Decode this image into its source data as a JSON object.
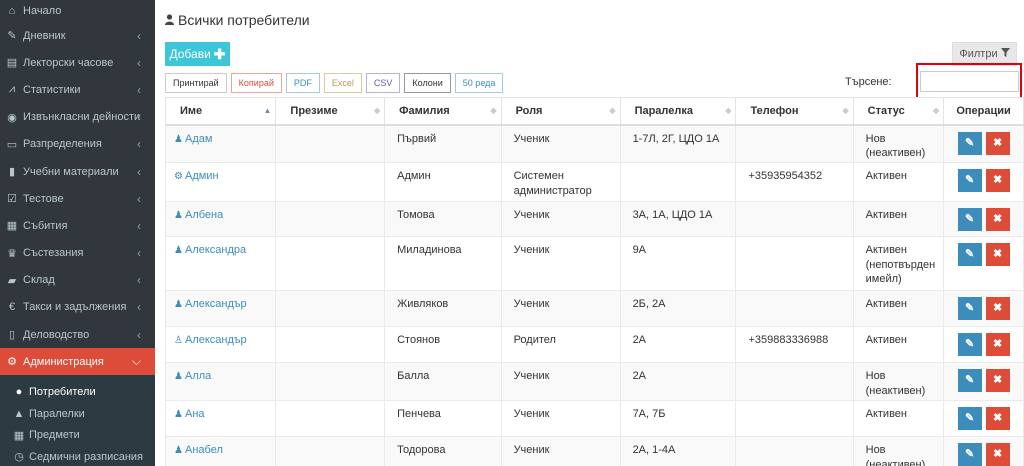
{
  "sidebar": {
    "items": [
      {
        "label": "Начало",
        "icon": "home-icon",
        "glyph": "⌂",
        "chevron": false,
        "active": false
      },
      {
        "label": "Дневник",
        "icon": "pencil-square-icon",
        "glyph": "✎",
        "chevron": true,
        "active": false
      },
      {
        "label": "Лекторски часове",
        "icon": "calendar-icon",
        "glyph": "▤",
        "chevron": true,
        "active": false
      },
      {
        "label": "Статистики",
        "icon": "line-chart-icon",
        "glyph": "⩘",
        "chevron": true,
        "active": false
      },
      {
        "label": "Извънкласни дейности",
        "icon": "soccer-ball-icon",
        "glyph": "◉",
        "chevron": true,
        "active": false
      },
      {
        "label": "Разпределения",
        "icon": "list-alt-icon",
        "glyph": "▭",
        "chevron": true,
        "active": false
      },
      {
        "label": "Учебни материали",
        "icon": "book-icon",
        "glyph": "▮",
        "chevron": true,
        "active": false
      },
      {
        "label": "Тестове",
        "icon": "check-square-icon",
        "glyph": "☑",
        "chevron": true,
        "active": false
      },
      {
        "label": "Събития",
        "icon": "calendar-icon",
        "glyph": "▦",
        "chevron": true,
        "active": false
      },
      {
        "label": "Състезания",
        "icon": "trophy-icon",
        "glyph": "♛",
        "chevron": true,
        "active": false
      },
      {
        "label": "Склад",
        "icon": "truck-icon",
        "glyph": "▰",
        "chevron": true,
        "active": false
      },
      {
        "label": "Такси и задължения",
        "icon": "euro-icon",
        "glyph": "€",
        "chevron": true,
        "active": false
      },
      {
        "label": "Деловодство",
        "icon": "file-icon",
        "glyph": "▯",
        "chevron": true,
        "active": false
      },
      {
        "label": "Администрация",
        "icon": "cogs-icon",
        "glyph": "⚙",
        "chevron": true,
        "active": true
      }
    ],
    "submenu": [
      {
        "label": "Потребители",
        "icon": "user-icon",
        "glyph": "●",
        "active": true
      },
      {
        "label": "Паралелки",
        "icon": "graduation-cap-icon",
        "glyph": "▲",
        "active": false
      },
      {
        "label": "Предмети",
        "icon": "table-icon",
        "glyph": "▦",
        "active": false
      },
      {
        "label": "Седмични разписания",
        "icon": "clock-icon",
        "glyph": "◷",
        "active": false
      }
    ]
  },
  "header": {
    "title": "Всички потребители",
    "title_icon": "user-icon"
  },
  "toolbar": {
    "add_label": "Добави",
    "filters_label": "Филтри",
    "buttons": [
      "Принтирай",
      "Копирай",
      "PDF",
      "Excel",
      "CSV",
      "Колони",
      "50 реда"
    ],
    "search_label": "Търсене:",
    "search_value": ""
  },
  "table": {
    "columns": [
      "Име",
      "Презиме",
      "Фамилия",
      "Роля",
      "Паралелка",
      "Телефон",
      "Статус",
      "Операции"
    ],
    "rows": [
      {
        "icon": "child-icon",
        "glyph": "♟",
        "name": "Адам",
        "middle": "",
        "last": "Първий",
        "role": "Ученик",
        "class": "1-7Л, 2Г, ЦДО 1А",
        "phone": "",
        "status": "Нов (неактивен)"
      },
      {
        "icon": "cog-icon",
        "glyph": "⚙",
        "name": "Админ",
        "middle": "",
        "last": "Админ",
        "role": "Системен администратор",
        "class": "",
        "phone": "+35935954352",
        "status": "Активен"
      },
      {
        "icon": "child-icon",
        "glyph": "♟",
        "name": "Албена",
        "middle": "",
        "last": "Томова",
        "role": "Ученик",
        "class": "3А, 1А, ЦДО 1А",
        "phone": "",
        "status": "Активен"
      },
      {
        "icon": "child-icon",
        "glyph": "♟",
        "name": "Александра",
        "middle": "",
        "last": "Миладинова",
        "role": "Ученик",
        "class": "9А",
        "phone": "",
        "status": "Активен (непотвърден имейл)"
      },
      {
        "icon": "child-icon",
        "glyph": "♟",
        "name": "Александър",
        "middle": "",
        "last": "Живляков",
        "role": "Ученик",
        "class": "2Б, 2А",
        "phone": "",
        "status": "Активен"
      },
      {
        "icon": "users-icon",
        "glyph": "♙",
        "name": "Александър",
        "middle": "",
        "last": "Стоянов",
        "role": "Родител",
        "class": "2А",
        "phone": "+359883336988",
        "status": "Активен"
      },
      {
        "icon": "child-icon",
        "glyph": "♟",
        "name": "Алла",
        "middle": "",
        "last": "Балла",
        "role": "Ученик",
        "class": "2А",
        "phone": "",
        "status": "Нов (неактивен)"
      },
      {
        "icon": "child-icon",
        "glyph": "♟",
        "name": "Ана",
        "middle": "",
        "last": "Пенчева",
        "role": "Ученик",
        "class": "7А, 7Б",
        "phone": "",
        "status": "Активен"
      },
      {
        "icon": "child-icon",
        "glyph": "♟",
        "name": "Анабел",
        "middle": "",
        "last": "Тодорова",
        "role": "Ученик",
        "class": "2А, 1-4А",
        "phone": "",
        "status": "Нов (неактивен)"
      }
    ]
  },
  "colors": {
    "sidebar_bg": "#32373d",
    "active_item": "#dd4b39",
    "add_button": "#3cc6d7",
    "edit_button": "#3c8dbc",
    "delete_button": "#dd4b39",
    "highlight_box": "#e0000f"
  }
}
